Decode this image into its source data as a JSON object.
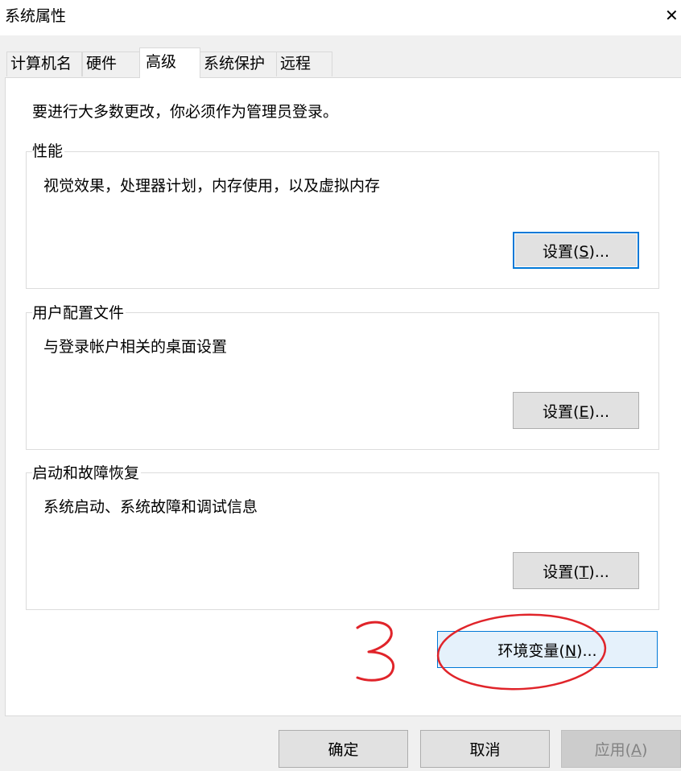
{
  "window": {
    "title": "系统属性",
    "close_glyph": "✕"
  },
  "tabs": [
    {
      "label": "计算机名",
      "active": false
    },
    {
      "label": "硬件",
      "active": false
    },
    {
      "label": "高级",
      "active": true
    },
    {
      "label": "系统保护",
      "active": false
    },
    {
      "label": "远程",
      "active": false
    }
  ],
  "notice": "要进行大多数更改，你必须作为管理员登录。",
  "groups": {
    "performance": {
      "legend": "性能",
      "description": "视觉效果，处理器计划，内存使用，以及虚拟内存",
      "button_text": "设置(",
      "button_key": "S",
      "button_suffix": ")..."
    },
    "user_profiles": {
      "legend": "用户配置文件",
      "description": "与登录帐户相关的桌面设置",
      "button_text": "设置(",
      "button_key": "E",
      "button_suffix": ")..."
    },
    "startup_recovery": {
      "legend": "启动和故障恢复",
      "description": "系统启动、系统故障和调试信息",
      "button_text": "设置(",
      "button_key": "T",
      "button_suffix": ")..."
    }
  },
  "env_button": {
    "text": "环境变量(",
    "key": "N",
    "suffix": ")..."
  },
  "footer": {
    "ok": "确定",
    "cancel": "取消",
    "apply_text": "应用(",
    "apply_key": "A",
    "apply_suffix": ")"
  },
  "annotation": {
    "step_number": "3",
    "color": "#e0242a"
  },
  "colors": {
    "focus_border": "#0078d7",
    "env_button_bg": "#e5f1fb"
  }
}
